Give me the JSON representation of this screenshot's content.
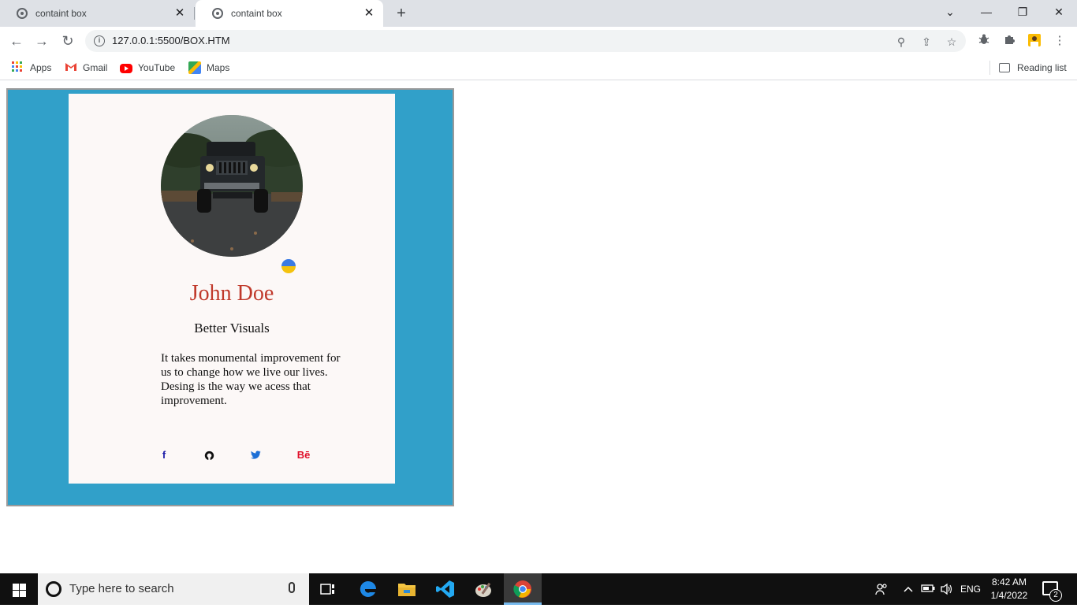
{
  "browser": {
    "tabs": [
      {
        "title": "containt box",
        "active": false
      },
      {
        "title": "containt box",
        "active": true
      }
    ],
    "url": "127.0.0.1:5500/BOX.HTM",
    "bookmarks": [
      {
        "label": "Apps",
        "icon": "apps-grid-icon"
      },
      {
        "label": "Gmail",
        "icon": "gmail-icon"
      },
      {
        "label": "YouTube",
        "icon": "youtube-icon"
      },
      {
        "label": "Maps",
        "icon": "maps-icon"
      }
    ],
    "reading_list": "Reading list",
    "icons": {
      "new_tab": "+",
      "close": "✕",
      "minimize": "—",
      "restore": "❐",
      "tab_search": "⌄",
      "back": "←",
      "forward": "→",
      "reload": "↻",
      "zoom": "⚲",
      "share": "⇪",
      "star": "☆",
      "menu": "⋮"
    }
  },
  "card": {
    "name": "John Doe",
    "role": "Better Visuals",
    "bio": "It takes monumental improvement for us to change how we live our lives. Desing is the way we acess that improvement.",
    "social": [
      {
        "glyph": "f",
        "network": "facebook",
        "color": "#1a1aa8"
      },
      {
        "glyph": "◉",
        "network": "github",
        "color": "#111111"
      },
      {
        "glyph": "🐦",
        "network": "twitter",
        "color": "#1d6fd6"
      },
      {
        "glyph": "Bē",
        "network": "behance",
        "color": "#e0102a"
      }
    ],
    "colors": {
      "box": "#31a0c9",
      "card": "#fcf8f7",
      "name": "#c0392b"
    }
  },
  "taskbar": {
    "search_placeholder": "Type here to search",
    "language": "ENG",
    "time": "8:42 AM",
    "date": "1/4/2022",
    "notification_count": "2"
  }
}
